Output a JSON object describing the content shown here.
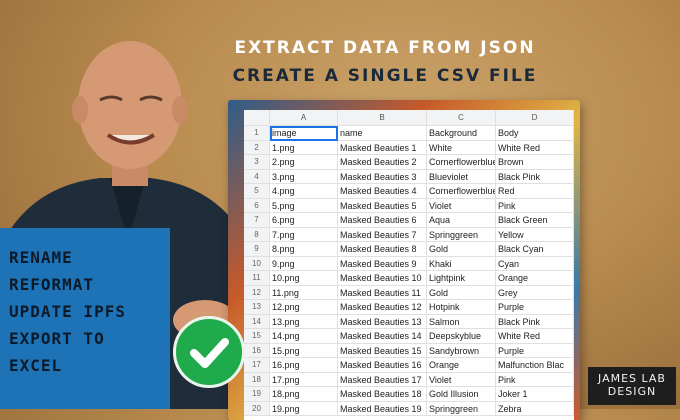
{
  "headline": {
    "line1": "EXTRACT DATA FROM JSON",
    "line2": "CREATE A SINGLE CSV FILE"
  },
  "panel": {
    "items": [
      "RENAME",
      "REFORMAT",
      "UPDATE IPFS",
      "EXPORT TO",
      "EXCEL"
    ]
  },
  "logo": {
    "line1": "JAMES LAB",
    "line2": "DESIGN"
  },
  "sheet": {
    "column_letters": [
      "A",
      "B",
      "C",
      "D"
    ],
    "rows": [
      {
        "n": "1",
        "a": "image",
        "b": "name",
        "c": "Background",
        "d": "Body"
      },
      {
        "n": "2",
        "a": "1.png",
        "b": "Masked Beauties 1",
        "c": "White",
        "d": "White Red"
      },
      {
        "n": "3",
        "a": "2.png",
        "b": "Masked Beauties 2",
        "c": "Cornerflowerblue",
        "d": "Brown"
      },
      {
        "n": "4",
        "a": "3.png",
        "b": "Masked Beauties 3",
        "c": "Blueviolet",
        "d": "Black Pink"
      },
      {
        "n": "5",
        "a": "4.png",
        "b": "Masked Beauties 4",
        "c": "Cornerflowerblue",
        "d": "Red"
      },
      {
        "n": "6",
        "a": "5.png",
        "b": "Masked Beauties 5",
        "c": "Violet",
        "d": "Pink"
      },
      {
        "n": "7",
        "a": "6.png",
        "b": "Masked Beauties 6",
        "c": "Aqua",
        "d": "Black Green"
      },
      {
        "n": "8",
        "a": "7.png",
        "b": "Masked Beauties 7",
        "c": "Springgreen",
        "d": "Yellow"
      },
      {
        "n": "9",
        "a": "8.png",
        "b": "Masked Beauties 8",
        "c": "Gold",
        "d": "Black Cyan"
      },
      {
        "n": "10",
        "a": "9.png",
        "b": "Masked Beauties 9",
        "c": "Khaki",
        "d": "Cyan"
      },
      {
        "n": "11",
        "a": "10.png",
        "b": "Masked Beauties 10",
        "c": "Lightpink",
        "d": "Orange"
      },
      {
        "n": "12",
        "a": "11.png",
        "b": "Masked Beauties 11",
        "c": "Gold",
        "d": "Grey"
      },
      {
        "n": "13",
        "a": "12.png",
        "b": "Masked Beauties 12",
        "c": "Hotpink",
        "d": "Purple"
      },
      {
        "n": "14",
        "a": "13.png",
        "b": "Masked Beauties 13",
        "c": "Salmon",
        "d": "Black Pink"
      },
      {
        "n": "15",
        "a": "14.png",
        "b": "Masked Beauties 14",
        "c": "Deepskyblue",
        "d": "White Red"
      },
      {
        "n": "16",
        "a": "15.png",
        "b": "Masked Beauties 15",
        "c": "Sandybrown",
        "d": "Purple"
      },
      {
        "n": "17",
        "a": "16.png",
        "b": "Masked Beauties 16",
        "c": "Orange",
        "d": "Malfunction Blac"
      },
      {
        "n": "18",
        "a": "17.png",
        "b": "Masked Beauties 17",
        "c": "Violet",
        "d": "Pink"
      },
      {
        "n": "19",
        "a": "18.png",
        "b": "Masked Beauties 18",
        "c": "Gold Illusion",
        "d": "Joker 1"
      },
      {
        "n": "20",
        "a": "19.png",
        "b": "Masked Beauties 19",
        "c": "Springgreen",
        "d": "Zebra"
      }
    ]
  },
  "icons": {
    "check": "checkmark-icon"
  },
  "colors": {
    "panel": "#1d73b6",
    "check": "#1faa4b",
    "selection": "#1a73e8"
  }
}
